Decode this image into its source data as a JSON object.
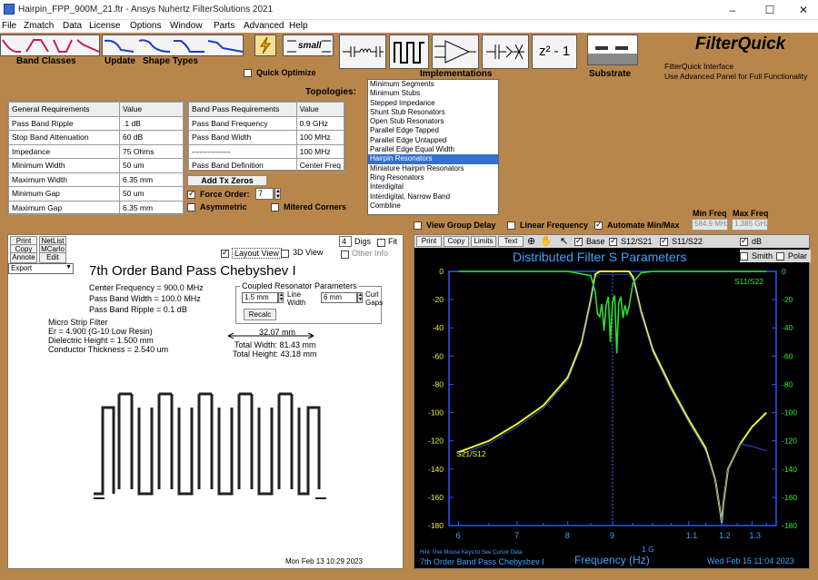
{
  "window": {
    "title": "Hairpin_FPP_900M_21.ftr - Ansys Nuhertz FilterSolutions 2021",
    "min": "–",
    "max": "☐",
    "close": "✕"
  },
  "menu": [
    "File",
    "Zmatch",
    "Data",
    "License",
    "Options",
    "Window",
    "Parts",
    "Advanced",
    "Help"
  ],
  "toolbar": {
    "band_classes": "Band Classes",
    "update": "Update",
    "shape_types": "Shape Types",
    "small": "small",
    "quick_optimize": "Quick Optimize",
    "implementations": "Implementations",
    "z_label": "z² - 1",
    "substrate": "Substrate",
    "brand": "FilterQuick",
    "brand_line1": "FilterQuick Interface",
    "brand_line2": "Use Advanced Panel for Full  Functionality",
    "topologies": "Topologies:"
  },
  "general_table": {
    "headers": [
      "General Requirements",
      "Value"
    ],
    "rows": [
      [
        "Pass Band Ripple",
        ".1 dB"
      ],
      [
        "Stop Band Attenuation",
        "60 dB"
      ],
      [
        "Impedance",
        "75 Ohms"
      ],
      [
        "Minimum Width",
        "50 um"
      ],
      [
        "Maximum Width",
        "6.35 mm"
      ],
      [
        "Minimum Gap",
        "50 um"
      ],
      [
        "Maximum Gap",
        "6.35 mm"
      ]
    ]
  },
  "bandpass_table": {
    "headers": [
      "Band Pass Requirements",
      "Value"
    ],
    "rows": [
      [
        "Pass Band Frequency",
        "0.9 GHz"
      ],
      [
        "Pass Band Width",
        "100 MHz"
      ],
      [
        "---------------",
        "100 MHz"
      ],
      [
        "Pass Band Definition",
        "Center Freq"
      ]
    ]
  },
  "tx": {
    "add_tx_zeros": "Add Tx Zeros",
    "force_order": "Force Order:",
    "order": "7",
    "asymmetric": "Asymmetric",
    "mitered": "Mitered Corners"
  },
  "topologies": {
    "items": [
      "Minimum Segments",
      "Minimum Stubs",
      "Stepped Impedance",
      "Shunt Stub Resonators",
      "Open Stub Resonators",
      "Parallel Edge Tapped",
      "Parallel Edge Untapped",
      "Parallel Edge Equal Width",
      "Hairpin Resonators",
      "Miniature Hairpin Resonators",
      "Ring Resonators",
      "Interdigital",
      "Interdigital, Narrow Band",
      "Combline"
    ],
    "selected": "Hairpin Resonators"
  },
  "view_options": {
    "group_delay": "View Group Delay",
    "linear_freq": "Linear Frequency",
    "automate": "Automate Min/Max",
    "min_freq_label": "Min Freq",
    "max_freq_label": "Max Freq",
    "min_freq": "584.9 MHz",
    "max_freq": "1.385 GHz"
  },
  "layout": {
    "print": "Print",
    "netlist": "NetList",
    "copy": "Copy",
    "mcarlo": "MCarlo",
    "annote": "Annote",
    "edit": "Edit",
    "export": "Export",
    "layout_view": "Layout View",
    "view3d": "3D View",
    "digs_value": "4",
    "digs": "Digs",
    "fit": "Fit",
    "other_info": "Other Info",
    "title": "7th Order Band Pass Chebyshev I",
    "center": "Center Frequency = 900.0 MHz",
    "pbw": "Pass Band Width = 100.0 MHz",
    "ripple": "Pass Band Ripple = 0.1 dB",
    "ms": "Micro Strip Filter",
    "er": "Er = 4.900 (G-10 Low Resin)",
    "dh": "Dielectric Height = 1.500 mm",
    "ct": "Conductor Thickness = 2.540 um",
    "coupled": "Coupled Resonator Parameters",
    "line_w_val": "1.5 mm",
    "line_w": "Line Width",
    "curl_val": "6 mm",
    "curl": "Curl Gaps",
    "recalc": "Recalc",
    "dim": "32.07 mm",
    "tw": "Total Width: 81.43 mm",
    "th": "Total Height: 43.18 mm",
    "date": "Mon Feb 13 10:29 2023"
  },
  "graph": {
    "print": "Print",
    "copy": "Copy",
    "limits": "Limits",
    "text": "Text",
    "base": "Base",
    "s12": "S12/S21",
    "s11": "S11/S22",
    "db": "dB",
    "smith": "Smith",
    "polar": "Polar",
    "title": "Distributed Filter S Parameters",
    "s11_label": "S11/S22",
    "s21_label": "S21/S12",
    "xlabel": "Frequency (Hz)",
    "hint": "Hint: Use Mouse Keys to See Cursor Data",
    "footer": "7th Order Band Pass Chebyshev I",
    "date": "Wed Feb 15 11:04 2023",
    "g_label": "1 G"
  },
  "chart_data": {
    "type": "line",
    "title": "Distributed Filter S Parameters",
    "xlabel": "Frequency (Hz)",
    "x_ticks": [
      "6",
      "7",
      "8",
      "9",
      "1.1",
      "1.2",
      "1.3"
    ],
    "y_left_ticks": [
      0,
      -20,
      -40,
      -60,
      -80,
      -100,
      -120,
      -140,
      -160,
      -180
    ],
    "y_right_ticks": [
      0,
      -20,
      -40,
      -60,
      -80,
      -100,
      -120,
      -140,
      -160,
      -180
    ],
    "ylim": [
      -180,
      0
    ],
    "series": [
      {
        "name": "S21/S12",
        "color": "#f0f030",
        "x": [
          0.6,
          0.65,
          0.7,
          0.75,
          0.8,
          0.83,
          0.85,
          0.86,
          0.87,
          0.88,
          0.9,
          0.92,
          0.93,
          0.94,
          0.95,
          0.97,
          1.0,
          1.05,
          1.1,
          1.15,
          1.18,
          1.195,
          1.2,
          1.205,
          1.22,
          1.26,
          1.3,
          1.35
        ],
        "y": [
          -128,
          -120,
          -108,
          -95,
          -75,
          -50,
          -20,
          -2,
          0,
          0,
          0,
          0,
          0,
          0,
          -4,
          -28,
          -55,
          -82,
          -105,
          -125,
          -148,
          -170,
          -178,
          -165,
          -140,
          -122,
          -110,
          -100
        ]
      },
      {
        "name": "S11/S22",
        "color": "#28e028",
        "x": [
          0.6,
          0.8,
          0.85,
          0.86,
          0.865,
          0.87,
          0.875,
          0.88,
          0.885,
          0.89,
          0.895,
          0.9,
          0.905,
          0.91,
          0.915,
          0.92,
          0.925,
          0.93,
          0.935,
          0.94,
          0.95,
          0.97,
          1.0,
          1.35
        ],
        "y": [
          0,
          0,
          -3,
          -15,
          -30,
          -32,
          -23,
          -42,
          -24,
          -18,
          -50,
          -22,
          -17,
          -58,
          -22,
          -18,
          -33,
          -24,
          -30,
          -25,
          -8,
          -1,
          0,
          0
        ]
      }
    ]
  }
}
